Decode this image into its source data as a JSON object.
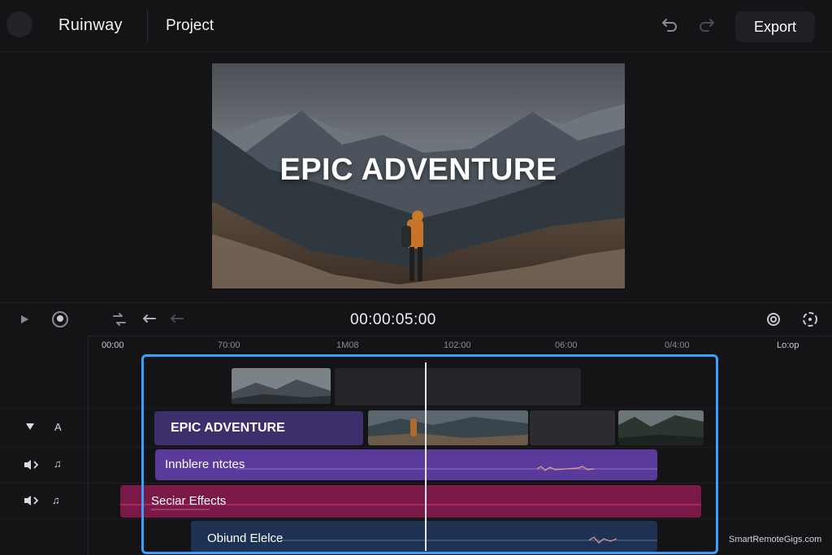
{
  "header": {
    "brand": "Ruinway",
    "project": "Project",
    "export_label": "Export",
    "icons": [
      "app-logo",
      "undo-icon",
      "redo-icon"
    ]
  },
  "preview": {
    "title": "EPIC ADVENTURE"
  },
  "controls": {
    "timecode": "00:00:05:00",
    "icons": [
      "play-icon",
      "record-icon",
      "loop-icon",
      "undo-icon",
      "redo-icon",
      "settings-icon",
      "fit-icon"
    ]
  },
  "ruler": {
    "ticks": [
      "00:00",
      "70:00",
      "1M08",
      "102:00",
      "06:00",
      "0/4:00",
      "Lo:op"
    ]
  },
  "tracks": {
    "headers": [
      {
        "icon": "collapse-triangle-icon",
        "label": "A"
      },
      {
        "icon": "audio-icon",
        "label": "♫"
      },
      {
        "icon": "audio-icon",
        "label": "♫"
      }
    ],
    "title_clip": "EPIC ADVENTURE",
    "music_clip": "Innblere ntctes",
    "sfx_clip": "Seciar Effects",
    "sound_clip": "Obiund Elelce"
  },
  "colors": {
    "selection": "#3aa0ff",
    "title_clip": "#3d2f6b",
    "music_clip": "#5a3a9a",
    "sfx_clip": "#7a1848",
    "sound_clip": "#1e3354"
  },
  "watermark": "SmartRemoteGigs.com"
}
